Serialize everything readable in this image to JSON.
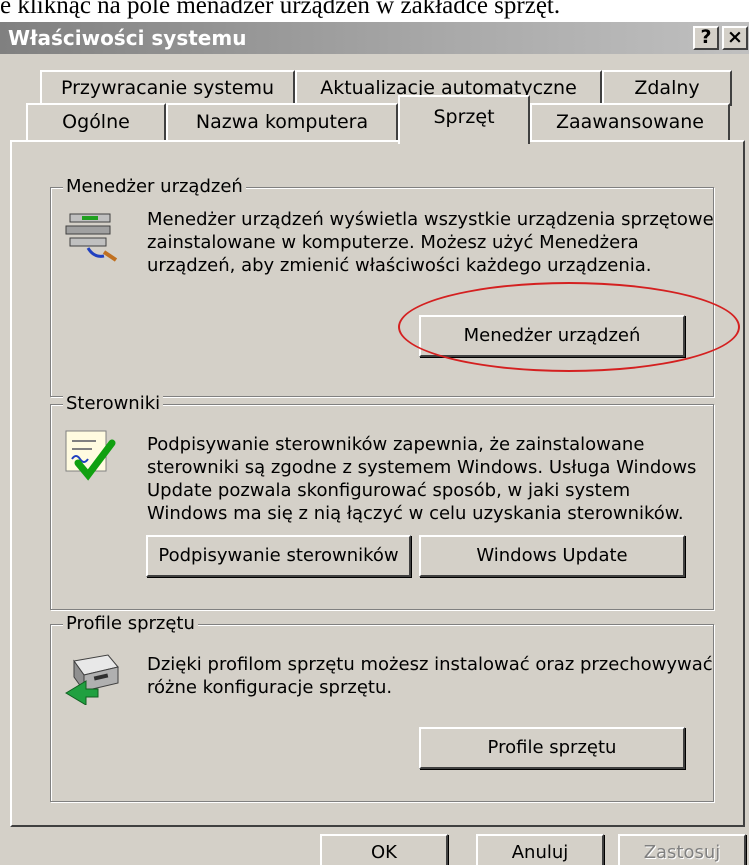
{
  "caption": "e kliknąc na pole menadżer urządzeń w zakładce sprzęt.",
  "window": {
    "title": "Właściwości systemu",
    "help_label": "?",
    "close_label": "×"
  },
  "tabs": {
    "row1": [
      "Przywracanie systemu",
      "Aktualizacje automatyczne",
      "Zdalny"
    ],
    "row2": [
      "Ogólne",
      "Nazwa komputera",
      "Sprzęt",
      "Zaawansowane"
    ],
    "active": "Sprzęt"
  },
  "device_manager": {
    "title": "Menedżer urządzeń",
    "description": [
      "Menedżer urządzeń wyświetla wszystkie urządzenia sprzętowe",
      "zainstalowane w komputerze. Możesz użyć Menedżera",
      "urządzeń, aby zmienić właściwości każdego urządzenia."
    ],
    "button_label": "Menedżer urządzeń",
    "icon": "device-manager-icon",
    "highlight_color": "#d42020"
  },
  "drivers": {
    "title": "Sterowniki",
    "description": [
      "Podpisywanie sterowników zapewnia, że zainstalowane",
      "sterowniki są zgodne z systemem Windows. Usługa Windows",
      "Update pozwala skonfigurować sposób, w jaki system",
      "Windows ma się z nią łączyć w celu uzyskania sterowników."
    ],
    "signing_button_label": "Podpisywanie sterowników",
    "update_button_label": "Windows Update",
    "icon": "driver-signing-icon"
  },
  "hardware_profiles": {
    "title": "Profile sprzętu",
    "description": [
      "Dzięki profilom sprzętu możesz instalować oraz przechowywać",
      "różne konfiguracje sprzętu."
    ],
    "button_label": "Profile sprzętu",
    "icon": "hardware-profiles-icon"
  },
  "footer": {
    "ok_label": "OK",
    "cancel_label": "Anuluj",
    "apply_label": "Zastosuj"
  },
  "colors": {
    "face": "#d4d0c8",
    "title_bar": "#a9a9a9",
    "disabled_text": "#808080"
  }
}
